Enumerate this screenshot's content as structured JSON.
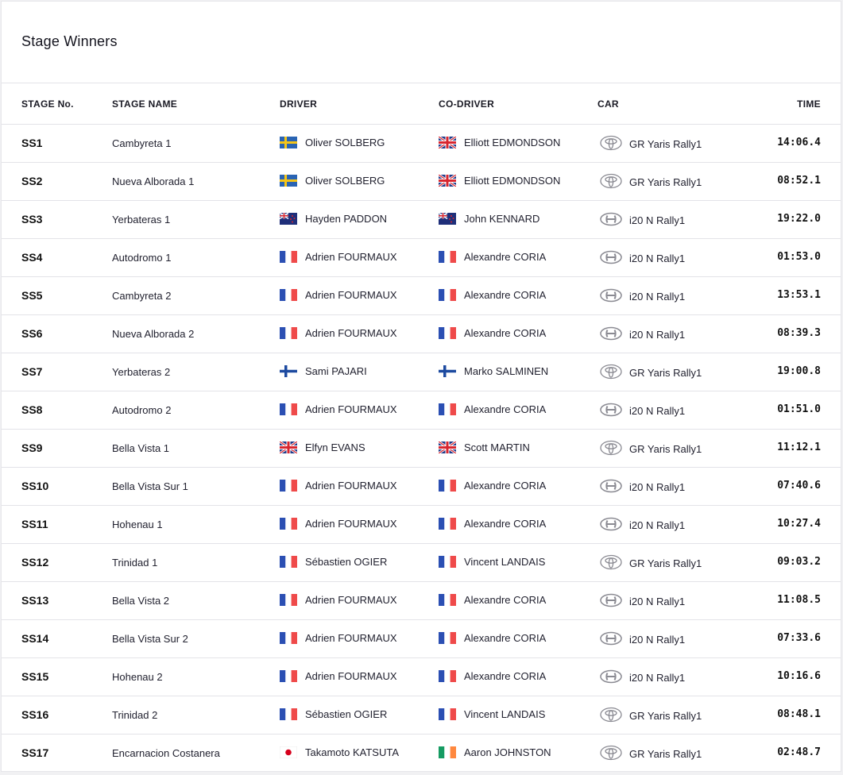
{
  "title": "Stage Winners",
  "headers": {
    "stage_no": "STAGE No.",
    "stage_name": "STAGE NAME",
    "driver": "DRIVER",
    "co_driver": "CO-DRIVER",
    "car": "CAR",
    "time": "TIME"
  },
  "rows": [
    {
      "stage": "SS1",
      "name": "Cambyreta 1",
      "driver": "Oliver SOLBERG",
      "driver_flag": "sweden-flag-icon",
      "codriver": "Elliott EDMONDSON",
      "codriver_flag": "uk-flag-icon",
      "car_logo": "toyota-logo-icon",
      "car": "GR Yaris Rally1",
      "time": "14:06.4"
    },
    {
      "stage": "SS2",
      "name": "Nueva Alborada 1",
      "driver": "Oliver SOLBERG",
      "driver_flag": "sweden-flag-icon",
      "codriver": "Elliott EDMONDSON",
      "codriver_flag": "uk-flag-icon",
      "car_logo": "toyota-logo-icon",
      "car": "GR Yaris Rally1",
      "time": "08:52.1"
    },
    {
      "stage": "SS3",
      "name": "Yerbateras 1",
      "driver": "Hayden PADDON",
      "driver_flag": "new-zealand-flag-icon",
      "codriver": "John KENNARD",
      "codriver_flag": "new-zealand-flag-icon",
      "car_logo": "hyundai-logo-icon",
      "car": "i20 N Rally1",
      "time": "19:22.0"
    },
    {
      "stage": "SS4",
      "name": "Autodromo 1",
      "driver": "Adrien FOURMAUX",
      "driver_flag": "france-flag-icon",
      "codriver": "Alexandre CORIA",
      "codriver_flag": "france-flag-icon",
      "car_logo": "hyundai-logo-icon",
      "car": "i20 N Rally1",
      "time": "01:53.0"
    },
    {
      "stage": "SS5",
      "name": "Cambyreta 2",
      "driver": "Adrien FOURMAUX",
      "driver_flag": "france-flag-icon",
      "codriver": "Alexandre CORIA",
      "codriver_flag": "france-flag-icon",
      "car_logo": "hyundai-logo-icon",
      "car": "i20 N Rally1",
      "time": "13:53.1"
    },
    {
      "stage": "SS6",
      "name": "Nueva Alborada 2",
      "driver": "Adrien FOURMAUX",
      "driver_flag": "france-flag-icon",
      "codriver": "Alexandre CORIA",
      "codriver_flag": "france-flag-icon",
      "car_logo": "hyundai-logo-icon",
      "car": "i20 N Rally1",
      "time": "08:39.3"
    },
    {
      "stage": "SS7",
      "name": "Yerbateras 2",
      "driver": "Sami PAJARI",
      "driver_flag": "finland-flag-icon",
      "codriver": "Marko SALMINEN",
      "codriver_flag": "finland-flag-icon",
      "car_logo": "toyota-logo-icon",
      "car": "GR Yaris Rally1",
      "time": "19:00.8"
    },
    {
      "stage": "SS8",
      "name": "Autodromo 2",
      "driver": "Adrien FOURMAUX",
      "driver_flag": "france-flag-icon",
      "codriver": "Alexandre CORIA",
      "codriver_flag": "france-flag-icon",
      "car_logo": "hyundai-logo-icon",
      "car": "i20 N Rally1",
      "time": "01:51.0"
    },
    {
      "stage": "SS9",
      "name": "Bella Vista 1",
      "driver": "Elfyn EVANS",
      "driver_flag": "uk-flag-icon",
      "codriver": "Scott MARTIN",
      "codriver_flag": "uk-flag-icon",
      "car_logo": "toyota-logo-icon",
      "car": "GR Yaris Rally1",
      "time": "11:12.1"
    },
    {
      "stage": "SS10",
      "name": "Bella Vista Sur 1",
      "driver": "Adrien FOURMAUX",
      "driver_flag": "france-flag-icon",
      "codriver": "Alexandre CORIA",
      "codriver_flag": "france-flag-icon",
      "car_logo": "hyundai-logo-icon",
      "car": "i20 N Rally1",
      "time": "07:40.6"
    },
    {
      "stage": "SS11",
      "name": "Hohenau 1",
      "driver": "Adrien FOURMAUX",
      "driver_flag": "france-flag-icon",
      "codriver": "Alexandre CORIA",
      "codriver_flag": "france-flag-icon",
      "car_logo": "hyundai-logo-icon",
      "car": "i20 N Rally1",
      "time": "10:27.4"
    },
    {
      "stage": "SS12",
      "name": "Trinidad 1",
      "driver": "Sébastien OGIER",
      "driver_flag": "france-flag-icon",
      "codriver": "Vincent LANDAIS",
      "codriver_flag": "france-flag-icon",
      "car_logo": "toyota-logo-icon",
      "car": "GR Yaris Rally1",
      "time": "09:03.2"
    },
    {
      "stage": "SS13",
      "name": "Bella Vista 2",
      "driver": "Adrien FOURMAUX",
      "driver_flag": "france-flag-icon",
      "codriver": "Alexandre CORIA",
      "codriver_flag": "france-flag-icon",
      "car_logo": "hyundai-logo-icon",
      "car": "i20 N Rally1",
      "time": "11:08.5"
    },
    {
      "stage": "SS14",
      "name": "Bella Vista Sur 2",
      "driver": "Adrien FOURMAUX",
      "driver_flag": "france-flag-icon",
      "codriver": "Alexandre CORIA",
      "codriver_flag": "france-flag-icon",
      "car_logo": "hyundai-logo-icon",
      "car": "i20 N Rally1",
      "time": "07:33.6"
    },
    {
      "stage": "SS15",
      "name": "Hohenau 2",
      "driver": "Adrien FOURMAUX",
      "driver_flag": "france-flag-icon",
      "codriver": "Alexandre CORIA",
      "codriver_flag": "france-flag-icon",
      "car_logo": "hyundai-logo-icon",
      "car": "i20 N Rally1",
      "time": "10:16.6"
    },
    {
      "stage": "SS16",
      "name": "Trinidad 2",
      "driver": "Sébastien OGIER",
      "driver_flag": "france-flag-icon",
      "codriver": "Vincent LANDAIS",
      "codriver_flag": "france-flag-icon",
      "car_logo": "toyota-logo-icon",
      "car": "GR Yaris Rally1",
      "time": "08:48.1"
    },
    {
      "stage": "SS17",
      "name": "Encarnacion Costanera",
      "driver": "Takamoto KATSUTA",
      "driver_flag": "japan-flag-icon",
      "codriver": "Aaron JOHNSTON",
      "codriver_flag": "ireland-flag-icon",
      "car_logo": "toyota-logo-icon",
      "car": "GR Yaris Rally1",
      "time": "02:48.7"
    }
  ]
}
